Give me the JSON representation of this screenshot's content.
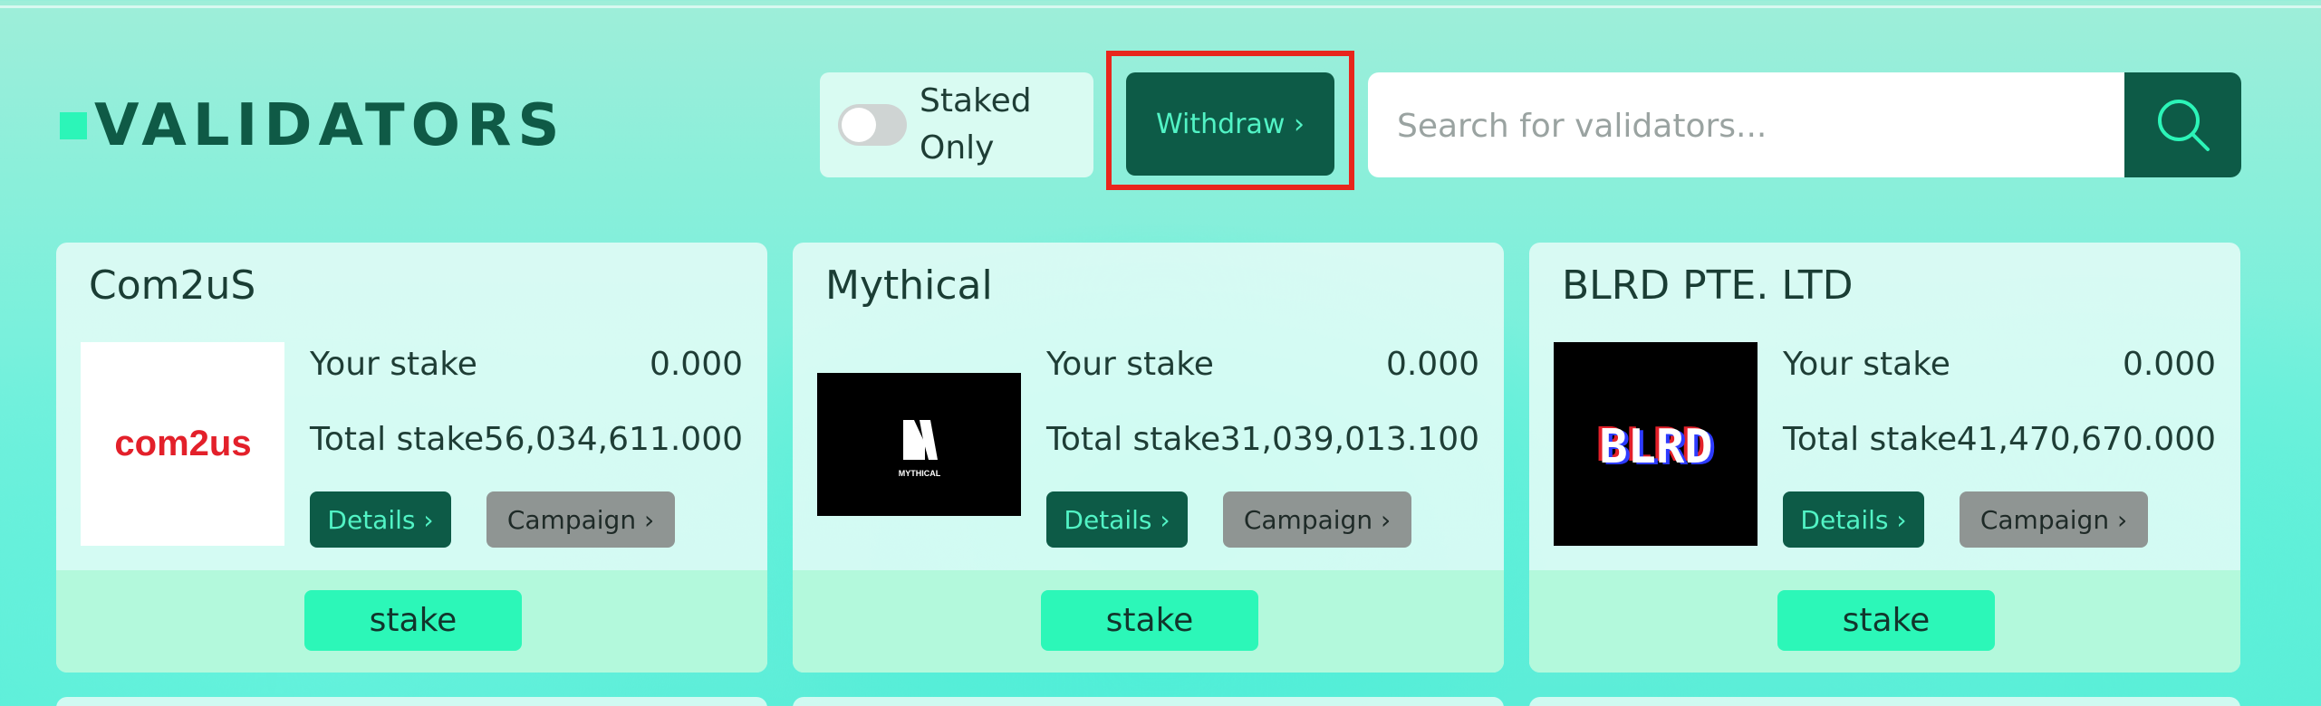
{
  "header": {
    "title": "VALIDATORS",
    "toggle_label": "Staked Only",
    "toggle_state": false,
    "withdraw_label": "Withdraw ›",
    "search_placeholder": "Search for validators...",
    "search_icon": "search-icon"
  },
  "colors": {
    "primary": "#0d5b47",
    "accent": "#2cf7b8",
    "highlight": "#e8261c",
    "campaign": "#8f9593"
  },
  "validators": [
    {
      "name": "Com2uS",
      "logo_text": "com2us",
      "your_stake_label": "Your stake",
      "your_stake": "0.000",
      "total_stake_label": "Total stake",
      "total_stake": "56,034,611.000",
      "details_label": "Details ›",
      "campaign_label": "Campaign ›",
      "stake_label": "stake"
    },
    {
      "name": "Mythical",
      "logo_text": "MYTHICAL",
      "your_stake_label": "Your stake",
      "your_stake": "0.000",
      "total_stake_label": "Total stake",
      "total_stake": "31,039,013.100",
      "details_label": "Details ›",
      "campaign_label": "Campaign ›",
      "stake_label": "stake"
    },
    {
      "name": "BLRD PTE. LTD",
      "logo_text": "BLRD",
      "your_stake_label": "Your stake",
      "your_stake": "0.000",
      "total_stake_label": "Total stake",
      "total_stake": "41,470,670.000",
      "details_label": "Details ›",
      "campaign_label": "Campaign ›",
      "stake_label": "stake"
    }
  ]
}
